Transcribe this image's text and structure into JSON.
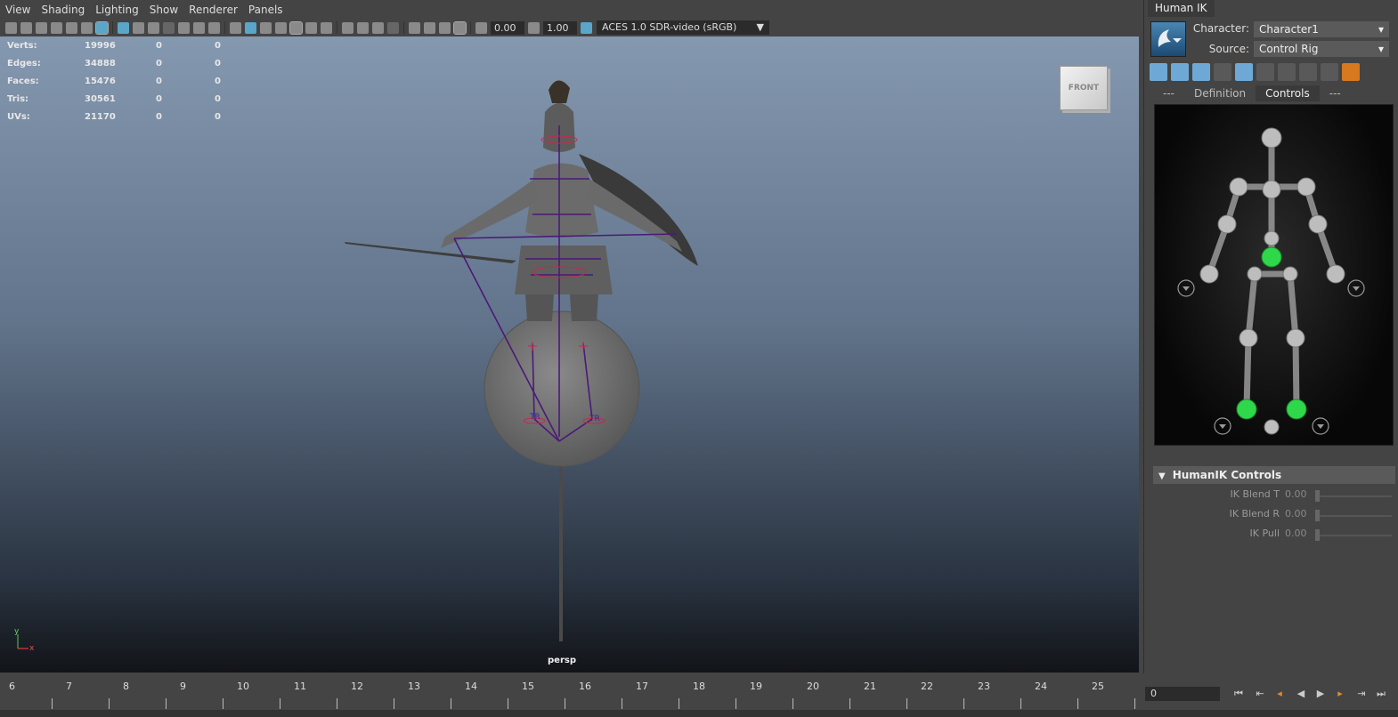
{
  "menubar": {
    "items": [
      "View",
      "Shading",
      "Lighting",
      "Show",
      "Renderer",
      "Panels"
    ]
  },
  "toolbar": {
    "exposure_value": "0.00",
    "gamma_value": "1.00",
    "color_space": "ACES 1.0 SDR-video (sRGB)"
  },
  "hud": {
    "rows": [
      {
        "label": "Verts:",
        "values": [
          "19996",
          "0",
          "0"
        ]
      },
      {
        "label": "Edges:",
        "values": [
          "34888",
          "0",
          "0"
        ]
      },
      {
        "label": "Faces:",
        "values": [
          "15476",
          "0",
          "0"
        ]
      },
      {
        "label": "Tris:",
        "values": [
          "30561",
          "0",
          "0"
        ]
      },
      {
        "label": "UVs:",
        "values": [
          "21170",
          "0",
          "0"
        ]
      }
    ]
  },
  "viewcube": {
    "face": "FRONT"
  },
  "viewport": {
    "camera": "persp",
    "axis_y": "y",
    "axis_x": "x",
    "background_top": "#8498b0",
    "background_bottom": "#121418"
  },
  "timeline": {
    "ticks": [
      "6",
      "7",
      "8",
      "9",
      "10",
      "11",
      "12",
      "13",
      "14",
      "15",
      "16",
      "17",
      "18",
      "19",
      "20",
      "21",
      "22",
      "23",
      "24",
      "25"
    ]
  },
  "playback": {
    "current_frame": "0",
    "buttons": [
      "go-to-start-icon",
      "step-back-key-icon",
      "step-back-frame-icon",
      "play-backward-icon",
      "play-forward-icon",
      "step-forward-frame-icon",
      "go-to-end-icon"
    ]
  },
  "hik": {
    "tab": "Human IK",
    "character_label": "Character:",
    "character_value": "Character1",
    "source_label": "Source:",
    "source_value": "Control Rig",
    "tabs": [
      "---",
      "Definition",
      "Controls",
      "---"
    ],
    "active_tab": "Controls",
    "controls_header": "HumanIK Controls",
    "sliders": [
      {
        "label": "IK Blend T",
        "value": "0.00"
      },
      {
        "label": "IK Blend R",
        "value": "0.00"
      },
      {
        "label": "IK Pull",
        "value": "0.00"
      }
    ],
    "accent": "#2fd84a"
  }
}
